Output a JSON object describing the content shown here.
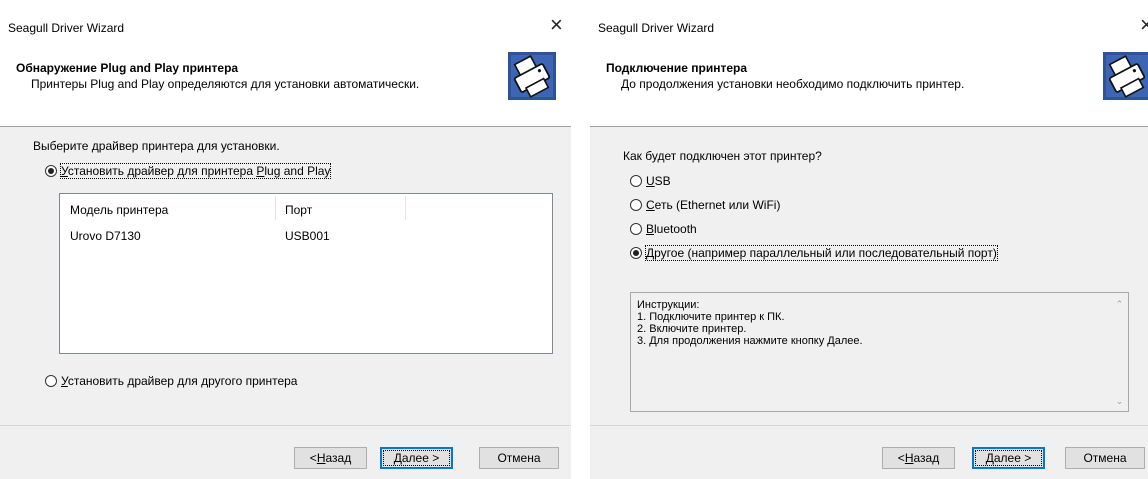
{
  "window_left": {
    "title": "Seagull Driver Wizard",
    "close_glyph": "×",
    "header_title": "Обнаружение Plug and Play принтера",
    "header_subtitle": "Принтеры Plug and Play определяются для установки автоматически.",
    "prompt": "Выберите драйвер принтера для установки.",
    "option_pnp": {
      "accel": "У",
      "rest": "становить драйвер для принтера ",
      "accel2": "P",
      "rest2": "lug and Play",
      "selected": true
    },
    "table": {
      "columns": [
        "Модель принтера",
        "Порт"
      ],
      "rows": [
        {
          "model": "Urovo D7130",
          "port": "USB001"
        }
      ]
    },
    "option_other": {
      "accel": "У",
      "rest": "становить драйвер для другого принтера",
      "selected": false
    },
    "buttons": {
      "back": {
        "prefix": "< ",
        "accel": "Н",
        "rest": "азад"
      },
      "next": {
        "accel": "Д",
        "rest": "алее >"
      },
      "cancel": "Отмена"
    }
  },
  "window_right": {
    "title": "Seagull Driver Wizard",
    "close_glyph": "×",
    "header_title": "Подключение принтера",
    "header_subtitle": "До продолжения установки необходимо подключить принтер.",
    "prompt": "Как будет подключен этот принтер?",
    "options": [
      {
        "accel": "U",
        "rest": "SB",
        "selected": false
      },
      {
        "accel": "С",
        "rest": "еть (Ethernet или WiFi)",
        "selected": false
      },
      {
        "accel": "B",
        "rest": "luetooth",
        "selected": false
      },
      {
        "accel": "Д",
        "rest": "ругое (например параллельный или последовательный порт)",
        "selected": true
      }
    ],
    "instructions": [
      "Инструкции:",
      "1. Подключите принтер к ПК.",
      "2. Включите принтер.",
      "3. Для продолжения нажмите кнопку Далее."
    ],
    "buttons": {
      "back": {
        "prefix": "< ",
        "accel": "Н",
        "rest": "азад"
      },
      "next": {
        "accel": "Д",
        "rest": "алее >"
      },
      "cancel": "Отмена"
    }
  },
  "colors": {
    "accent": "#0078d7",
    "dialog_bg": "#f0f0f0",
    "header_bg": "#ffffff",
    "icon_bg": "#2f5496"
  },
  "icons": {
    "wizard": "printer-icon",
    "close": "close-icon"
  }
}
